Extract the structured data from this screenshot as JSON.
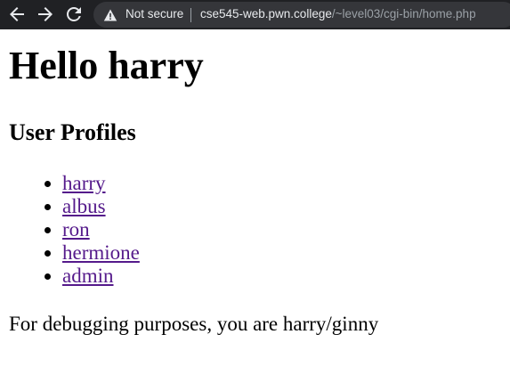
{
  "browser": {
    "security_label": "Not secure",
    "url_host": "cse545-web.pwn.college",
    "url_path": "/~level03/cgi-bin/home.php",
    "icons": {
      "back": "arrow-left-icon",
      "forward": "arrow-right-icon",
      "reload": "reload-icon",
      "security": "warning-triangle-icon"
    },
    "colors": {
      "toolbar": "#202124",
      "omnibox": "#35363a",
      "text": "#e8eaed",
      "path_text": "#9aa0a6"
    }
  },
  "page": {
    "heading": "Hello harry",
    "subheading": "User Profiles",
    "profiles": [
      "harry",
      "albus",
      "ron",
      "hermione",
      "admin"
    ],
    "debug_text": "For debugging purposes, you are harry/ginny",
    "colors": {
      "link": "#551a8b",
      "text": "#000000",
      "background": "#ffffff"
    }
  }
}
